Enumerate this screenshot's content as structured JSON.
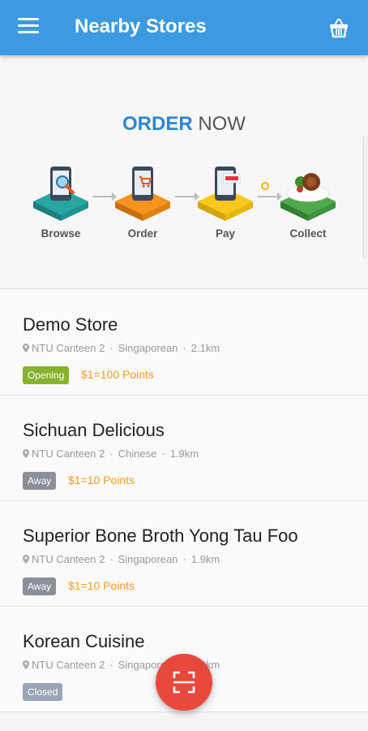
{
  "header": {
    "title": "Nearby Stores",
    "menu_icon": "hamburger-icon",
    "cart_icon": "basket-icon"
  },
  "banner": {
    "headline_strong": "ORDER",
    "headline_rest": " NOW",
    "steps": [
      {
        "label": "Browse",
        "color": "#26a5a3"
      },
      {
        "label": "Order",
        "color": "#f7941d"
      },
      {
        "label": "Pay",
        "color": "#f9c81a"
      },
      {
        "label": "Collect",
        "color": "#4ea94b"
      }
    ]
  },
  "stores": [
    {
      "name": "Demo Store",
      "location": "NTU Canteen 2",
      "cuisine": "Singaporean",
      "distance": "2.1km",
      "status": "Opening",
      "status_color": "#84b32c",
      "points": "$1=100 Points"
    },
    {
      "name": "Sichuan Delicious",
      "location": "NTU Canteen 2",
      "cuisine": "Chinese",
      "distance": "1.9km",
      "status": "Away",
      "status_color": "#8a8f9a",
      "points": "$1=10 Points"
    },
    {
      "name": "Superior Bone Broth Yong Tau Foo",
      "location": "NTU Canteen 2",
      "cuisine": "Singaporean",
      "distance": "1.9km",
      "status": "Away",
      "status_color": "#8a8f9a",
      "points": "$1=10 Points"
    },
    {
      "name": "Korean Cuisine",
      "location": "NTU Canteen 2",
      "cuisine": "Singaporean",
      "distance": "1.9km",
      "status": "Closed",
      "status_color": "#9aa6b8"
    }
  ],
  "fab": {
    "icon": "scan-icon"
  }
}
